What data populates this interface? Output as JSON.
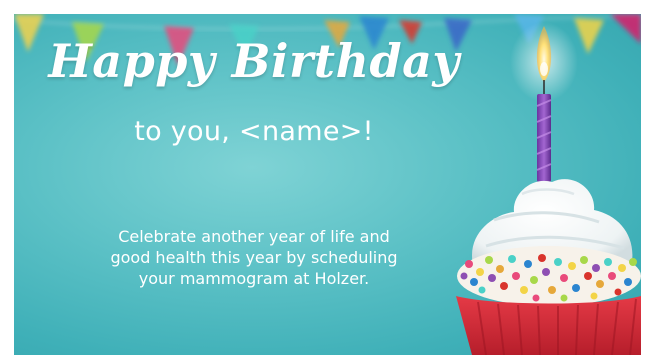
{
  "card": {
    "headline": "Happy Birthday",
    "subhead": "to you, <name>!",
    "body_lines": [
      "Celebrate another year of life and",
      "good health this year by scheduling",
      "your mammogram at Holzer."
    ]
  },
  "colors": {
    "background": "#5cc1c6",
    "frosting": "#ffffff",
    "liner": "#d8283a",
    "candle": "#8e4fb3",
    "flame": "#ffd24d"
  },
  "icons": {
    "bunting": "pennant-flags-icon",
    "cupcake": "cupcake-icon",
    "candle": "candle-icon"
  }
}
